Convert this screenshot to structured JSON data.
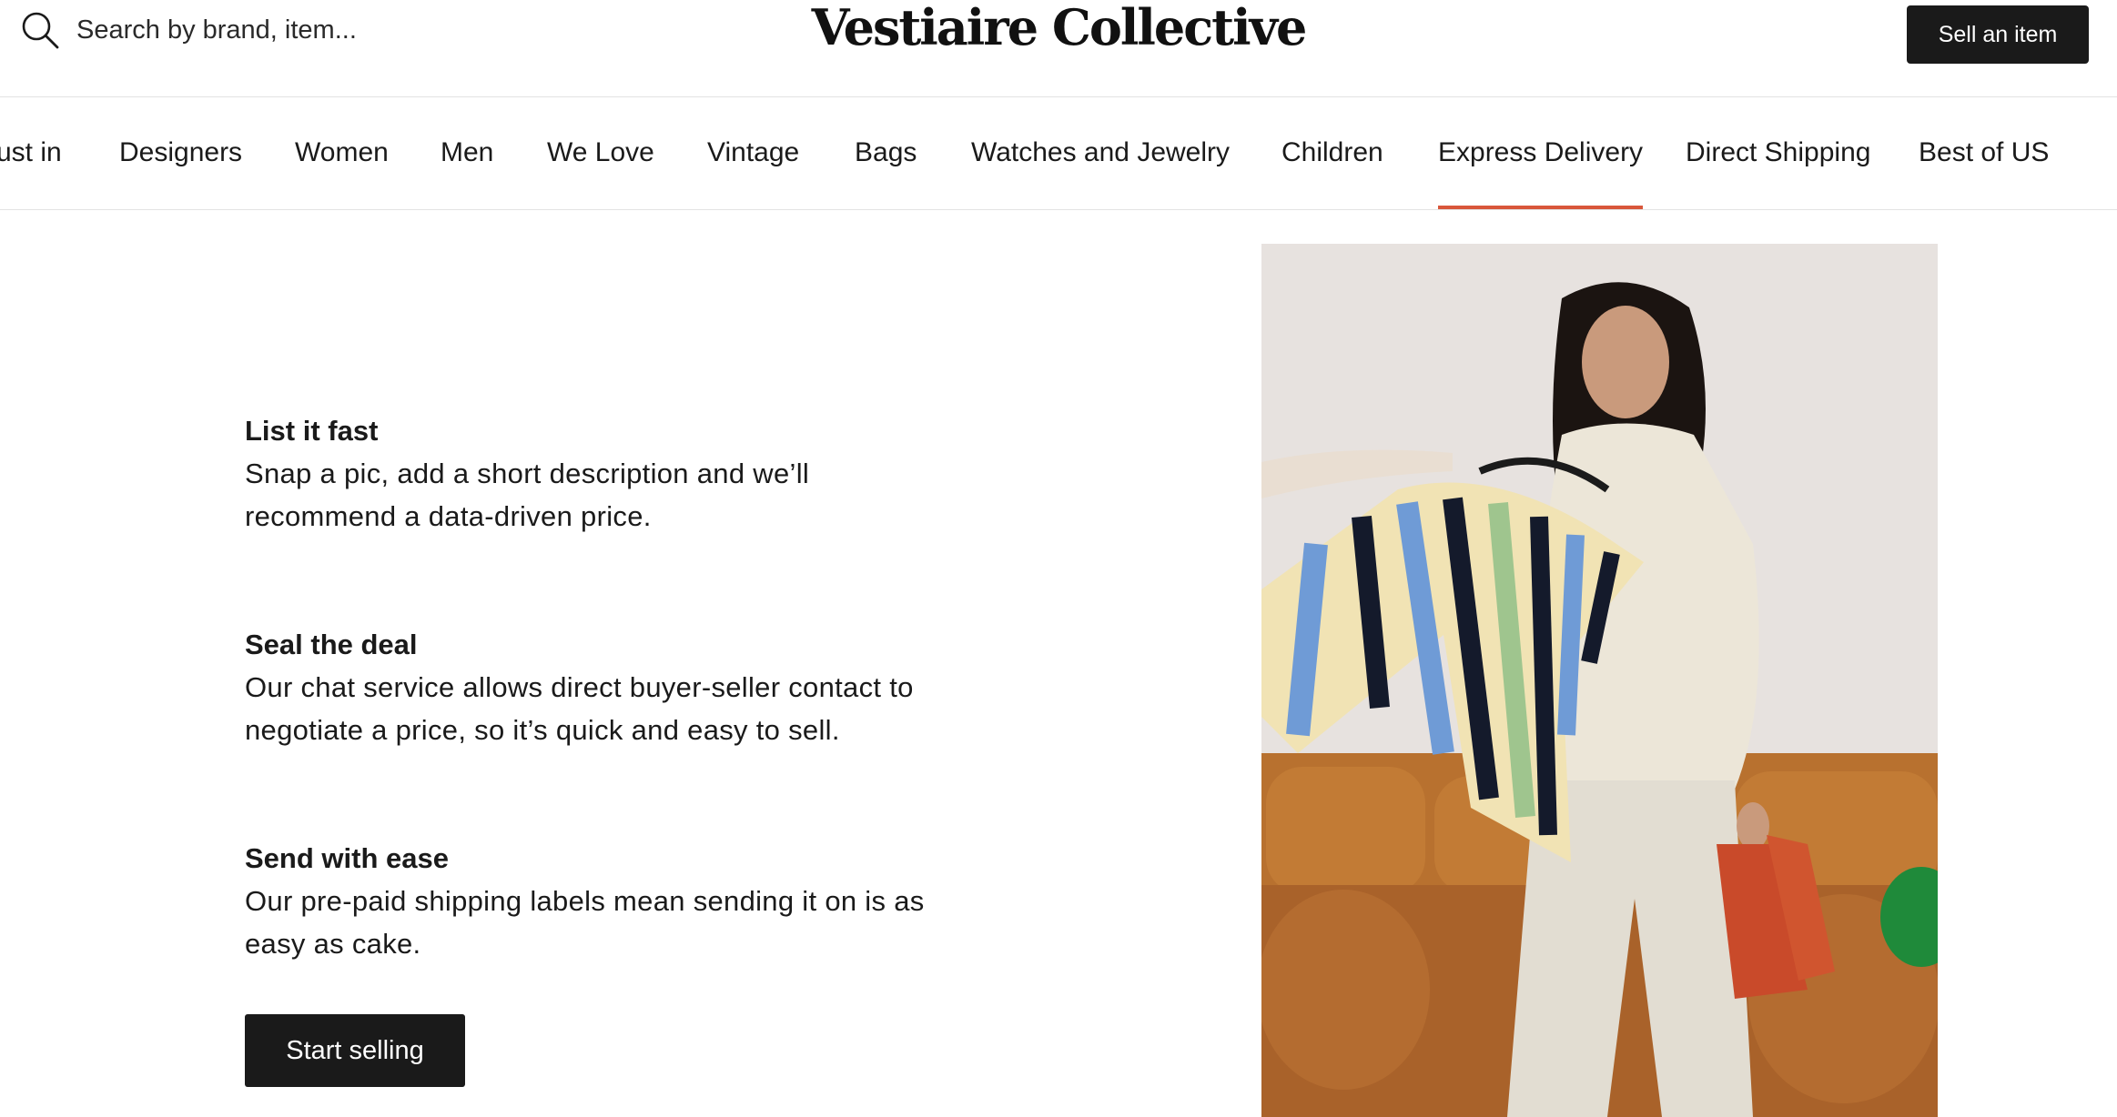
{
  "search": {
    "placeholder": "Search by brand, item..."
  },
  "header": {
    "logo": "Vestiaire Collective",
    "sell_label": "Sell an item"
  },
  "nav": {
    "items": [
      {
        "label": "ust in"
      },
      {
        "label": "Designers"
      },
      {
        "label": "Women"
      },
      {
        "label": "Men"
      },
      {
        "label": "We Love"
      },
      {
        "label": "Vintage"
      },
      {
        "label": "Bags"
      },
      {
        "label": "Watches and Jewelry"
      },
      {
        "label": "Children"
      },
      {
        "label": "Express Delivery",
        "active": true
      },
      {
        "label": "Direct Shipping"
      },
      {
        "label": "Best of US"
      }
    ]
  },
  "features": [
    {
      "title": "List it fast",
      "desc_line1": "Snap a pic, add a short description and we’ll",
      "desc_line2": "recommend a data-driven price."
    },
    {
      "title": "Seal the deal",
      "desc_line1": "Our chat service allows direct buyer-seller contact to",
      "desc_line2": "negotiate a price, so it’s quick and easy to sell."
    },
    {
      "title": "Send with ease",
      "desc_line1": "Our pre-paid shipping labels mean sending it on is as",
      "desc_line2": "easy as cake."
    }
  ],
  "cta": {
    "label": "Start selling"
  },
  "colors": {
    "accent": "#d9573b",
    "button_bg": "#1a1a1a"
  },
  "icons": {
    "search": "search-icon"
  }
}
